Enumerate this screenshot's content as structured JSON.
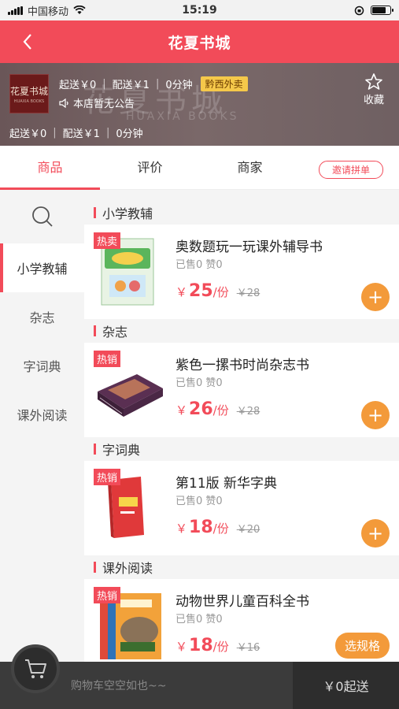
{
  "status_bar": {
    "carrier": "中国移动",
    "time": "15:19"
  },
  "nav": {
    "title": "花夏书城"
  },
  "shop": {
    "logo_text": "花夏书城",
    "logo_sub": "HUAXIA BOOKS",
    "watermark_title": "花夏书城",
    "watermark_sub": "HUAXIA BOOKS",
    "min_order": "起送￥0",
    "delivery_fee": "配送￥1",
    "delivery_time": "0分钟",
    "delivery_tag": "黔西外卖",
    "notice": "本店暂无公告",
    "favorite_label": "收藏"
  },
  "tabs": [
    {
      "label": "商品"
    },
    {
      "label": "评价"
    },
    {
      "label": "商家"
    }
  ],
  "invite_label": "邀请拼单",
  "categories": [
    {
      "label": "小学教辅"
    },
    {
      "label": "杂志"
    },
    {
      "label": "字词典"
    },
    {
      "label": "课外阅读"
    }
  ],
  "sections": [
    {
      "title": "小学教辅",
      "product": {
        "badge": "热卖",
        "name": "奥数题玩一玩课外辅导书",
        "stats": "已售0 赞0",
        "currency": "￥",
        "price": "25",
        "unit": "/份",
        "old_price": "￥28",
        "action": "+"
      }
    },
    {
      "title": "杂志",
      "product": {
        "badge": "热销",
        "name": "紫色一摞书时尚杂志书",
        "stats": "已售0 赞0",
        "currency": "￥",
        "price": "26",
        "unit": "/份",
        "old_price": "￥28",
        "action": "+"
      }
    },
    {
      "title": "字词典",
      "product": {
        "badge": "热销",
        "name": "第11版 新华字典",
        "stats": "已售0 赞0",
        "currency": "￥",
        "price": "18",
        "unit": "/份",
        "old_price": "￥20",
        "action": "+"
      }
    },
    {
      "title": "课外阅读",
      "product": {
        "badge": "热销",
        "name": "动物世界儿童百科全书",
        "stats": "已售0 赞0",
        "currency": "￥",
        "price": "18",
        "unit": "/份",
        "old_price": "￥16",
        "action": "选规格"
      }
    }
  ],
  "cart": {
    "empty_text": "购物车空空如也~~",
    "checkout_label": "￥0起送"
  },
  "colors": {
    "brand_red": "#f24b59",
    "accent_orange": "#f39a3a",
    "cart_dark": "#3b3b3b"
  }
}
